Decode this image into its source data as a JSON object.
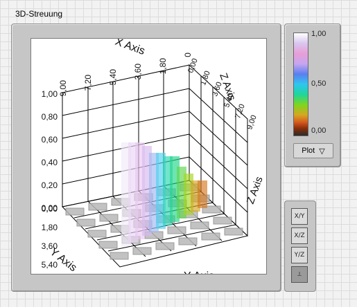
{
  "window": {
    "title": "3D-Streuung"
  },
  "colorbar": {
    "max_label": "1,00",
    "mid_label": "0,50",
    "min_label": "0,00"
  },
  "plot_button": {
    "label": "Plot"
  },
  "toolbar": {
    "tools": [
      {
        "name": "xy-plane-view",
        "label": "X/Y"
      },
      {
        "name": "xz-plane-view",
        "label": "X/Z"
      },
      {
        "name": "yz-plane-view",
        "label": "Y/Z"
      },
      {
        "name": "rotate-3d",
        "label": "⟂"
      }
    ]
  },
  "axes": {
    "z_ticks": [
      "1,00",
      "0,80",
      "0,60",
      "0,40",
      "0,20",
      "0,00"
    ],
    "x_ticks": [
      "9,00",
      "7,20",
      "5,40",
      "3,60",
      "1,80",
      "0"
    ],
    "y_ticks": [
      "0,00",
      "1,80",
      "3,60",
      "5,40",
      "7,20",
      "9,00"
    ],
    "x_label": "X Axis",
    "y_label": "Y Axis",
    "z_label": "Z Axis",
    "bottom_label": "Y Axis"
  }
}
